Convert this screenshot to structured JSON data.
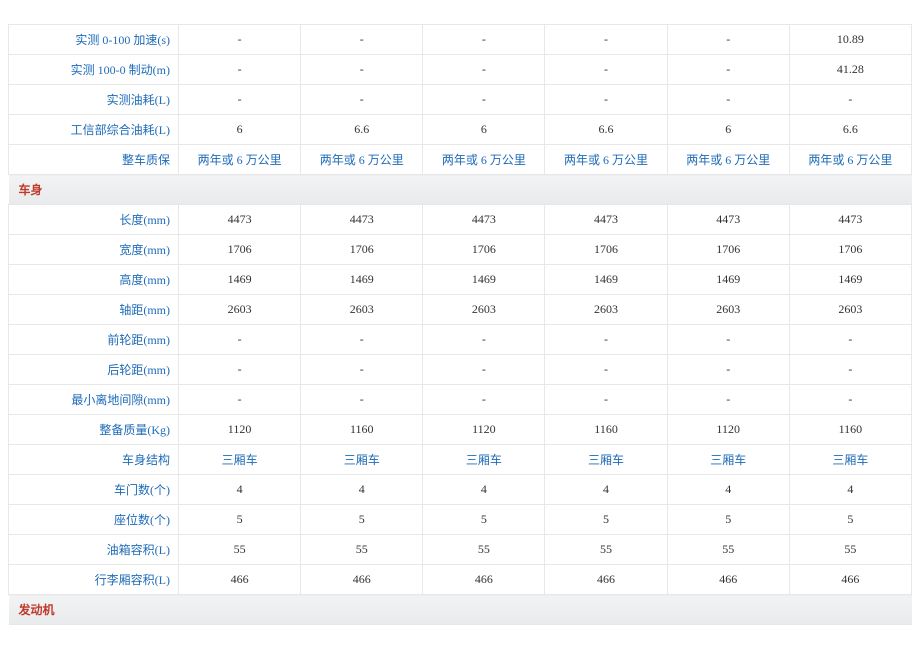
{
  "rows": [
    {
      "type": "data",
      "label": "实测 0-100 加速(s)",
      "labelLink": true,
      "values": [
        "-",
        "-",
        "-",
        "-",
        "-",
        "10.89"
      ]
    },
    {
      "type": "data",
      "label": "实测 100-0 制动(m)",
      "labelLink": true,
      "values": [
        "-",
        "-",
        "-",
        "-",
        "-",
        "41.28"
      ]
    },
    {
      "type": "data",
      "label": "实测油耗(L)",
      "labelLink": true,
      "values": [
        "-",
        "-",
        "-",
        "-",
        "-",
        "-"
      ]
    },
    {
      "type": "data",
      "label": "工信部综合油耗(L)",
      "labelLink": true,
      "values": [
        "6",
        "6.6",
        "6",
        "6.6",
        "6",
        "6.6"
      ]
    },
    {
      "type": "data",
      "label": "整车质保",
      "labelLink": true,
      "valueLink": true,
      "values": [
        "两年或 6 万公里",
        "两年或 6 万公里",
        "两年或 6 万公里",
        "两年或 6 万公里",
        "两年或 6 万公里",
        "两年或 6 万公里"
      ]
    },
    {
      "type": "section",
      "label": "车身"
    },
    {
      "type": "data",
      "label": "长度(mm)",
      "labelLink": true,
      "values": [
        "4473",
        "4473",
        "4473",
        "4473",
        "4473",
        "4473"
      ]
    },
    {
      "type": "data",
      "label": "宽度(mm)",
      "labelLink": true,
      "values": [
        "1706",
        "1706",
        "1706",
        "1706",
        "1706",
        "1706"
      ]
    },
    {
      "type": "data",
      "label": "高度(mm)",
      "labelLink": true,
      "values": [
        "1469",
        "1469",
        "1469",
        "1469",
        "1469",
        "1469"
      ]
    },
    {
      "type": "data",
      "label": "轴距(mm)",
      "labelLink": true,
      "values": [
        "2603",
        "2603",
        "2603",
        "2603",
        "2603",
        "2603"
      ]
    },
    {
      "type": "data",
      "label": "前轮距(mm)",
      "labelLink": true,
      "values": [
        "-",
        "-",
        "-",
        "-",
        "-",
        "-"
      ]
    },
    {
      "type": "data",
      "label": "后轮距(mm)",
      "labelLink": true,
      "values": [
        "-",
        "-",
        "-",
        "-",
        "-",
        "-"
      ]
    },
    {
      "type": "data",
      "label": "最小离地间隙(mm)",
      "labelLink": true,
      "values": [
        "-",
        "-",
        "-",
        "-",
        "-",
        "-"
      ]
    },
    {
      "type": "data",
      "label": "整备质量(Kg)",
      "labelLink": true,
      "values": [
        "1120",
        "1160",
        "1120",
        "1160",
        "1120",
        "1160"
      ]
    },
    {
      "type": "data",
      "label": "车身结构",
      "labelLink": true,
      "valueLink": true,
      "values": [
        "三厢车",
        "三厢车",
        "三厢车",
        "三厢车",
        "三厢车",
        "三厢车"
      ]
    },
    {
      "type": "data",
      "label": "车门数(个)",
      "labelLink": true,
      "values": [
        "4",
        "4",
        "4",
        "4",
        "4",
        "4"
      ]
    },
    {
      "type": "data",
      "label": "座位数(个)",
      "labelLink": true,
      "values": [
        "5",
        "5",
        "5",
        "5",
        "5",
        "5"
      ]
    },
    {
      "type": "data",
      "label": "油箱容积(L)",
      "labelLink": true,
      "values": [
        "55",
        "55",
        "55",
        "55",
        "55",
        "55"
      ]
    },
    {
      "type": "data",
      "label": "行李厢容积(L)",
      "labelLink": true,
      "values": [
        "466",
        "466",
        "466",
        "466",
        "466",
        "466"
      ]
    },
    {
      "type": "section",
      "label": "发动机"
    }
  ]
}
